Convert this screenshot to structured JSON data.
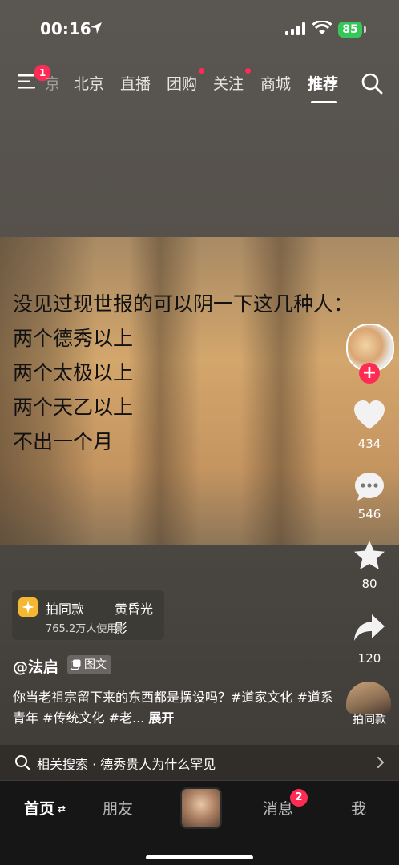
{
  "status_bar": {
    "time": "00:16",
    "battery": "85"
  },
  "top_nav": {
    "menu_badge": "1",
    "faded_tab": "京",
    "tabs": [
      {
        "label": "北京"
      },
      {
        "label": "直播"
      },
      {
        "label": "团购"
      },
      {
        "label": "关注"
      },
      {
        "label": "商城"
      },
      {
        "label": "推荐"
      }
    ]
  },
  "post": {
    "headline_lines": [
      "没见过现世报的可以阴一下这几种人：",
      "两个德秀以上",
      "两个太极以上",
      "两个天乙以上",
      "不出一个月"
    ],
    "likes": "434",
    "comments": "546",
    "favorites": "80",
    "shares": "120",
    "template": {
      "title": "拍同款",
      "name": "黄昏光影",
      "users": "765.2万人使用"
    },
    "author": "@法启",
    "type_tag": "图文",
    "description": "你当老祖宗留下来的东西都是摆设吗？#道家文化 #道系青年 #传统文化 #老...",
    "expand_label": "展开",
    "music_label": "拍同款"
  },
  "related_search": {
    "text": "相关搜索 · 德秀贵人为什么罕见"
  },
  "bottom_nav": {
    "home": "首页",
    "friends": "朋友",
    "messages": "消息",
    "messages_badge": "2",
    "me": "我"
  },
  "colors": {
    "accent": "#fe2c55",
    "battery": "#34c759"
  }
}
